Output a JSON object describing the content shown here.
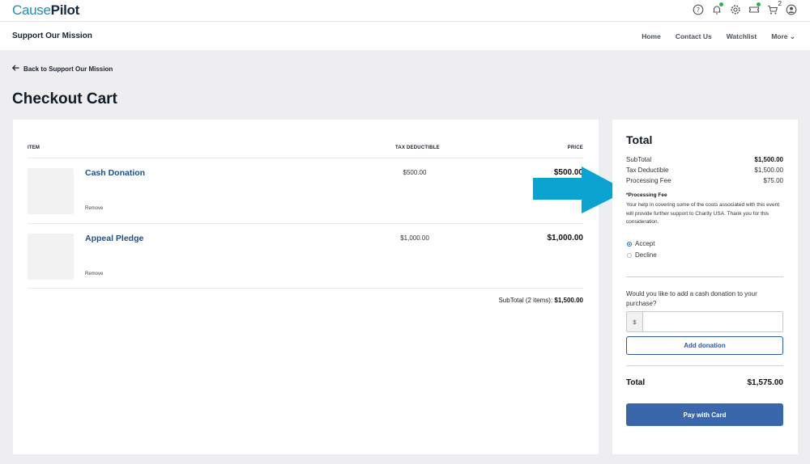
{
  "brand": {
    "part1": "Cause",
    "part2": "Pilot"
  },
  "top_icons": [
    "help-icon",
    "bell-icon",
    "gear-icon",
    "ticket-icon",
    "cart-icon",
    "user-icon"
  ],
  "cart_count": "2",
  "nav": {
    "site_title": "Support Our Mission",
    "links": [
      "Home",
      "Contact Us",
      "Watchlist",
      "More"
    ]
  },
  "back_link": "Back to Support Our Mission",
  "page_title": "Checkout Cart",
  "cart": {
    "headers": {
      "item": "ITEM",
      "tax": "TAX DEDUCTIBLE",
      "price": "PRICE"
    },
    "items": [
      {
        "name": "Cash Donation",
        "remove": "Remove",
        "tax": "$500.00",
        "price": "$500.00"
      },
      {
        "name": "Appeal Pledge",
        "remove": "Remove",
        "tax": "$1,000.00",
        "price": "$1,000.00"
      }
    ],
    "subtotal_label": "SubTotal (2 items):",
    "subtotal_value": "$1,500.00"
  },
  "summary": {
    "title": "Total",
    "rows": [
      {
        "label": "SubTotal",
        "value": "$1,500.00"
      },
      {
        "label": "Tax Deductible",
        "value": "$1,500.00"
      },
      {
        "label": "Processing Fee",
        "value": "$75.00"
      }
    ],
    "fee_label": "*Processing Fee",
    "fee_text": "Your help in covering some of the costs associated with this event will provide further support to Charity USA. Thank you for this consideration.",
    "options": [
      {
        "label": "Accept",
        "selected": true
      },
      {
        "label": "Decline",
        "selected": false
      }
    ],
    "donation_question": "Would you like to add a cash donation to your purchase?",
    "currency_prefix": "$",
    "amount_value": "",
    "add_button": "Add donation",
    "total_label": "Total",
    "total_value": "$1,575.00",
    "pay_button": "Pay with Card"
  },
  "colors": {
    "accent": "#3a67ac",
    "link": "#1d4e8c",
    "arrow": "#0aa3cf",
    "brand_light": "#1c8fb8"
  }
}
